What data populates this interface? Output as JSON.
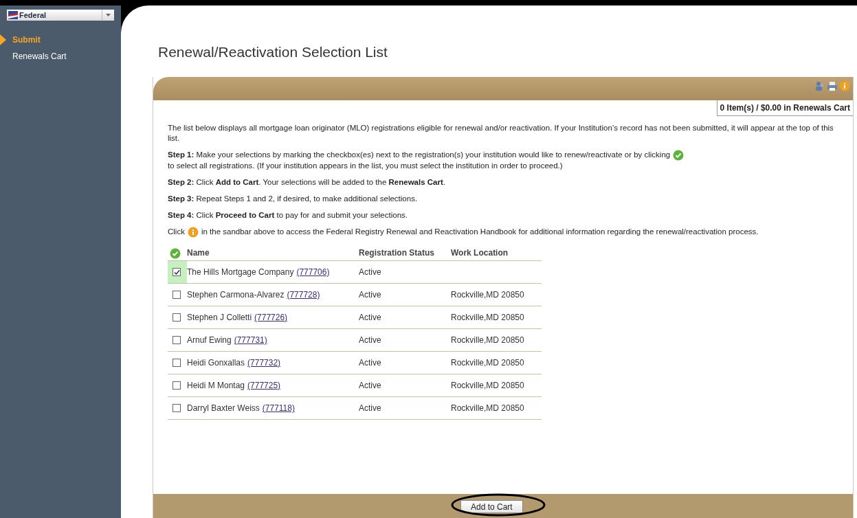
{
  "sidebar": {
    "dropdown": "Federal",
    "items": [
      {
        "label": "Submit",
        "selected": true
      },
      {
        "label": "Renewals Cart",
        "selected": false
      }
    ]
  },
  "title": "Renewal/Reactivation Selection List",
  "cart_summary": "0 Item(s) / $0.00 in Renewals Cart",
  "paragraphs": [
    [
      {
        "kind": "text",
        "text": "The list below displays all mortgage loan originator (MLO) registrations eligible for renewal and/or reactivation. If your Institution’s record has not been submitted, it will appear at the top of this list."
      }
    ],
    [
      {
        "kind": "text",
        "text": "**Step 1:** Make your selections by marking the checkbox(es) next to the registration(s) your institution would like to renew/reactivate or by clicking"
      },
      {
        "kind": "check"
      },
      {
        "kind": "text",
        "text": "to select all registrations. (If your institution appears in the list, you must select the institution in order to proceed.)"
      }
    ],
    [
      {
        "kind": "text",
        "text": "**Step 2:** Click **Add to Cart**. Your selections will be added to the **Renewals Cart**."
      }
    ],
    [
      {
        "kind": "text",
        "text": "**Step 3:** Repeat Steps 1 and 2, if desired, to make additional selections."
      }
    ],
    [
      {
        "kind": "text",
        "text": "**Step 4:** Click **Proceed to Cart** to pay for and submit your selections."
      }
    ],
    [
      {
        "kind": "text",
        "text": "Click"
      },
      {
        "kind": "help"
      },
      {
        "kind": "text",
        "text": "in the sandbar above to access the Federal Registry Renewal and Reactivation Handbook for additional information regarding the renewal/reactivation process."
      }
    ]
  ],
  "table": {
    "columns": [
      "Name",
      "Registration Status",
      "Work Location"
    ],
    "rows": [
      {
        "checked": true,
        "name": "The Hills Mortgage Company",
        "link": "(777706)",
        "status": "Active"
      },
      {
        "checked": false,
        "name": "Stephen Carmona-Alvarez",
        "link": "(777728)",
        "status": "Active",
        "location": "Rockville,MD 20850"
      },
      {
        "checked": false,
        "name": "Stephen J Colletti",
        "link": "(777726)",
        "status": "Active",
        "location": "Rockville,MD 20850"
      },
      {
        "checked": false,
        "name": "Arnuf Ewing",
        "link": "(777731)",
        "status": "Active",
        "location": "Rockville,MD 20850"
      },
      {
        "checked": false,
        "name": "Heidi Gonxallas",
        "link": "(777732)",
        "status": "Active",
        "location": "Rockville,MD 20850"
      },
      {
        "checked": false,
        "name": "Heidi M Montag",
        "link": "(777725)",
        "status": "Active",
        "location": "Rockville,MD 20850"
      },
      {
        "checked": false,
        "name": "Darryl Baxter Weiss",
        "link": "(777118)",
        "status": "Active",
        "location": "Rockville,MD 20850"
      }
    ]
  },
  "button": "Add to Cart"
}
